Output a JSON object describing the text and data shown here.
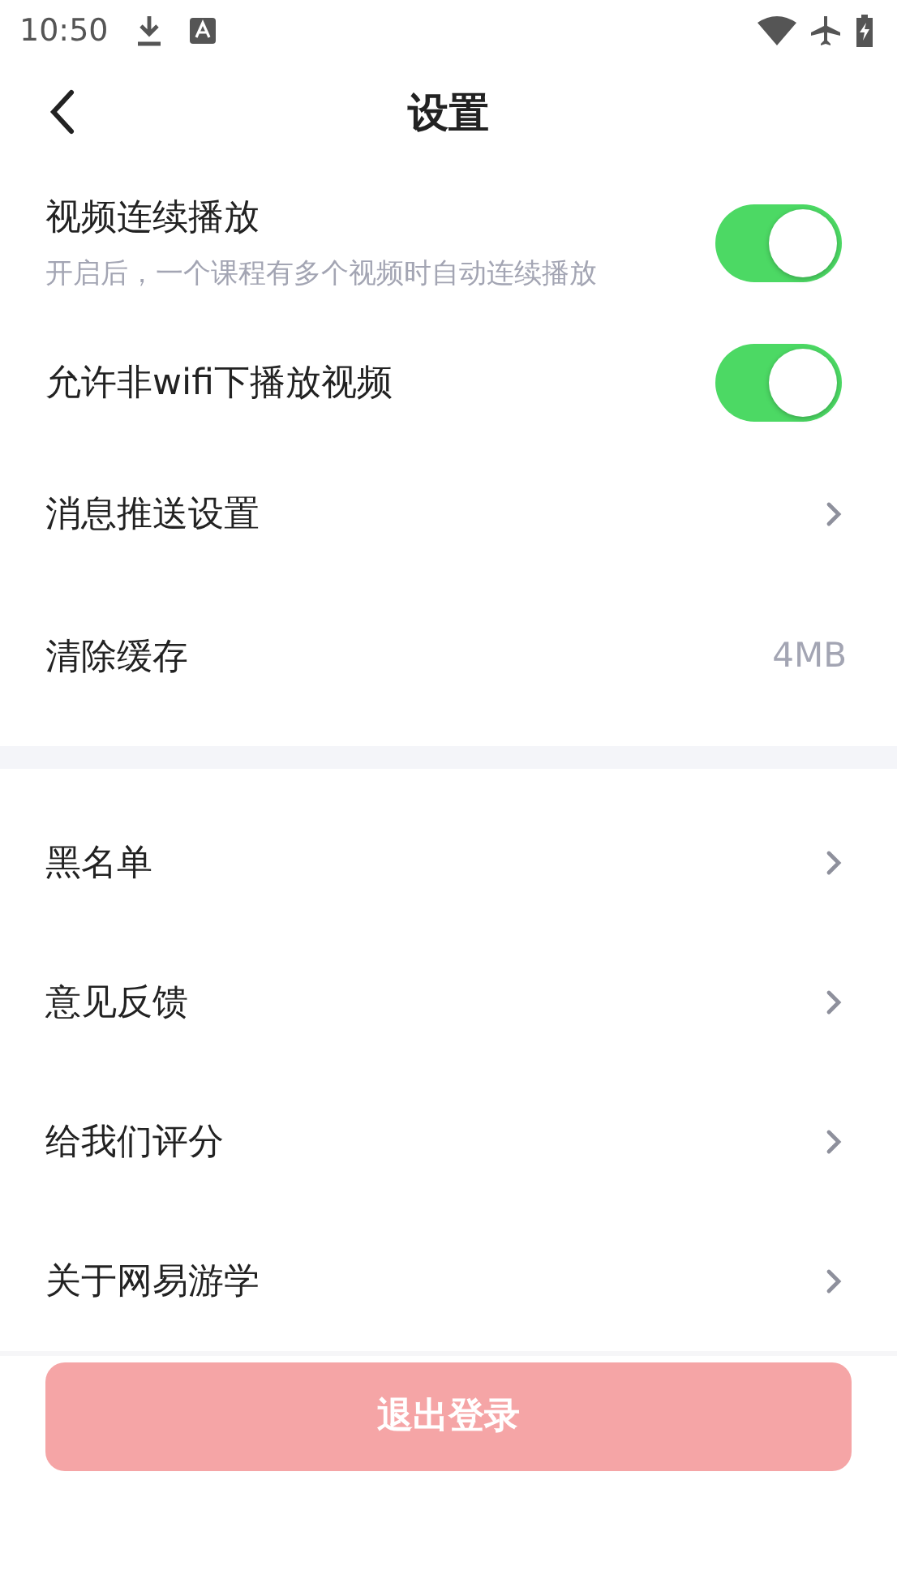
{
  "status_bar": {
    "time": "10:50"
  },
  "header": {
    "title": "设置"
  },
  "sections": [
    {
      "items": [
        {
          "kind": "toggle",
          "label": "视频连续播放",
          "description": "开启后，一个课程有多个视频时自动连续播放",
          "on": true
        },
        {
          "kind": "toggle",
          "label": "允许非wifi下播放视频",
          "on": true
        },
        {
          "kind": "link",
          "label": "消息推送设置"
        },
        {
          "kind": "value",
          "label": "清除缓存",
          "value": "4MB"
        }
      ]
    },
    {
      "items": [
        {
          "kind": "link",
          "label": "黑名单"
        },
        {
          "kind": "link",
          "label": "意见反馈"
        },
        {
          "kind": "link",
          "label": "给我们评分"
        },
        {
          "kind": "link",
          "label": "关于网易游学"
        }
      ]
    }
  ],
  "logout_button": {
    "label": "退出登录",
    "disabled": true
  }
}
